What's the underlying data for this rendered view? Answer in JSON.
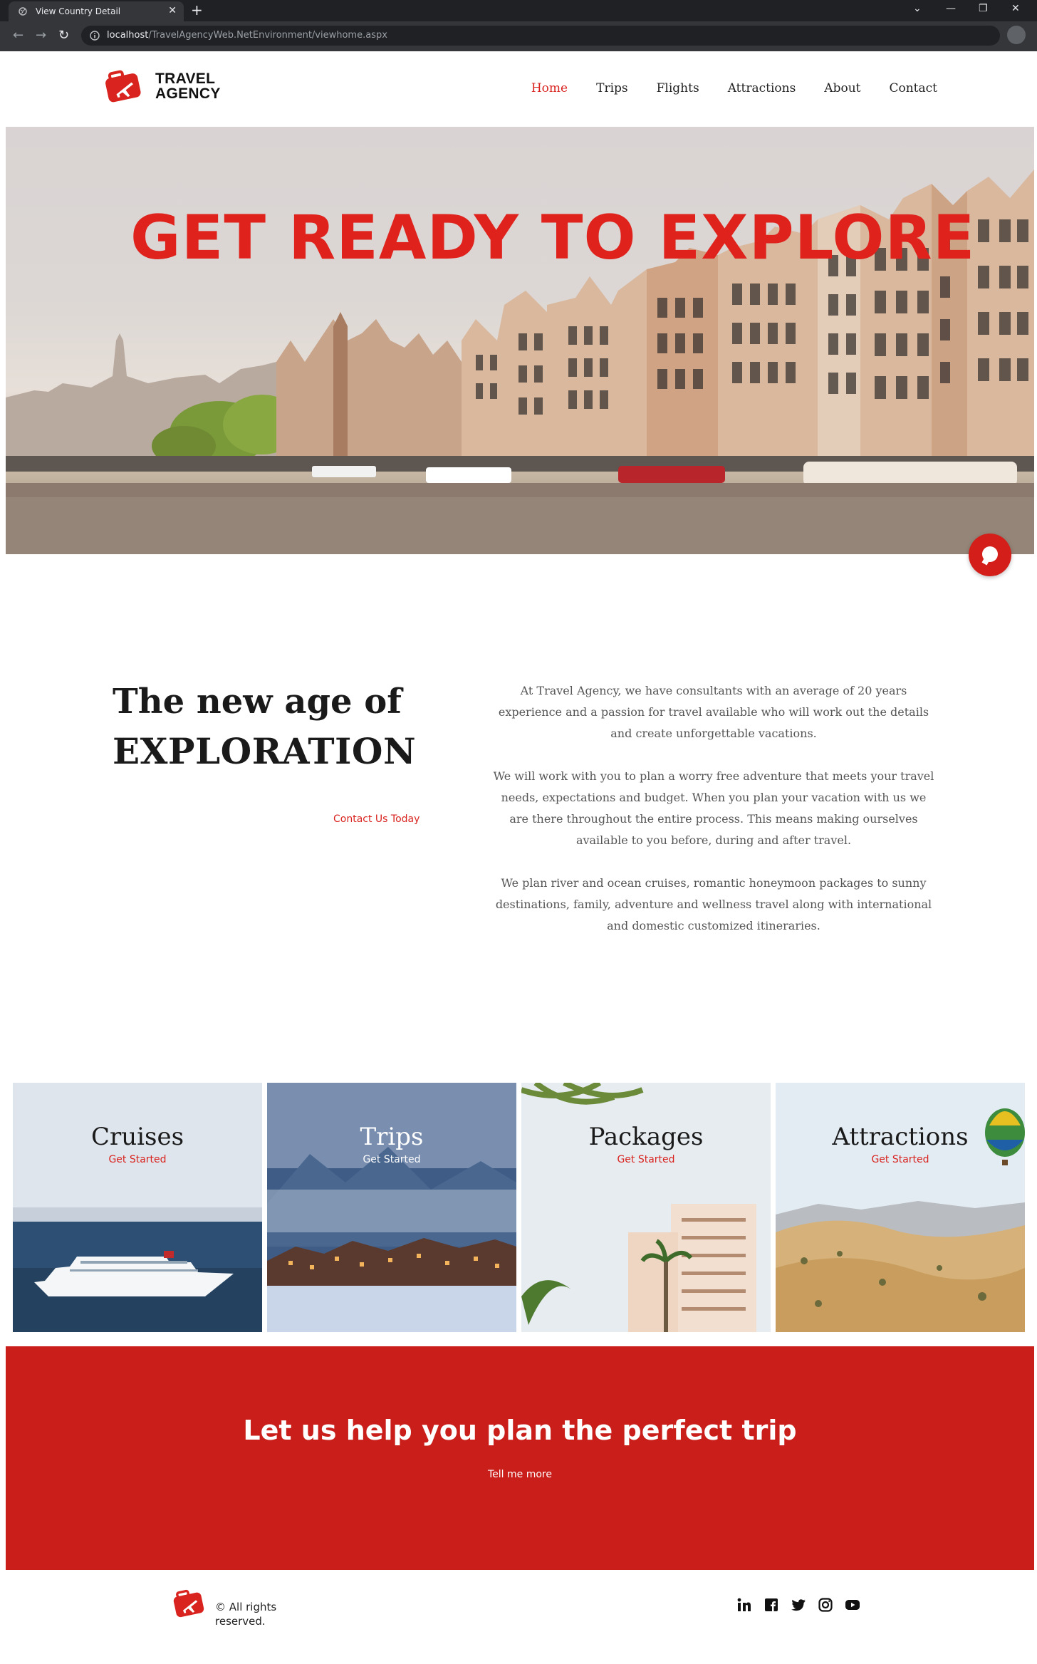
{
  "browser": {
    "tab_title": "View Country Detail",
    "tab_close": "✕",
    "new_tab": "+",
    "url_host": "localhost",
    "url_path": "/TravelAgencyWeb.NetEnvironment/viewhome.aspx",
    "controls": {
      "minimize": "—",
      "restore": "❐",
      "close": "✕",
      "dropdown": "⌄"
    }
  },
  "header": {
    "logo_line1": "TRAVEL",
    "logo_line2": "AGENCY",
    "nav": [
      {
        "label": "Home",
        "active": true
      },
      {
        "label": "Trips"
      },
      {
        "label": "Flights"
      },
      {
        "label": "Attractions"
      },
      {
        "label": "About"
      },
      {
        "label": "Contact"
      }
    ]
  },
  "hero": {
    "title": "GET READY TO EXPLORE",
    "chat_icon": "chat-bubble-icon"
  },
  "intro": {
    "heading_line1": "The new age of",
    "heading_line2": "EXPLORATION",
    "contact_link": "Contact Us Today",
    "paragraphs": [
      "At Travel Agency, we have consultants with an average of 20 years experience and a passion for travel available who will work out the details and create unforgettable vacations.",
      "We will work with you to plan a worry free adventure that meets your travel needs, expectations and budget. When you plan your vacation with us we are there throughout the entire process. This means making ourselves available to you before, during and after travel.",
      "We plan river and ocean cruises, romantic honeymoon packages to sunny destinations, family, adventure and wellness travel along with international and domestic customized itineraries."
    ]
  },
  "tiles": [
    {
      "title": "Cruises",
      "link": "Get Started"
    },
    {
      "title": "Trips",
      "link": "Get Started"
    },
    {
      "title": "Packages",
      "link": "Get Started"
    },
    {
      "title": "Attractions",
      "link": "Get Started"
    }
  ],
  "cta": {
    "title": "Let us help you plan the perfect trip",
    "link": "Tell me more"
  },
  "footer": {
    "copyright": "© All rights reserved.",
    "socials": [
      "linkedin-icon",
      "facebook-icon",
      "twitter-icon",
      "instagram-icon",
      "youtube-icon"
    ]
  },
  "colors": {
    "brand_red": "#d9231f",
    "cta_red": "#c91e19"
  }
}
